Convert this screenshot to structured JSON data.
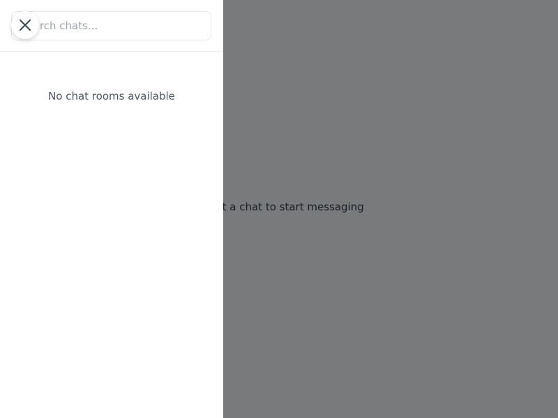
{
  "main": {
    "placeholder_text": "Select a chat to start messaging"
  },
  "sidebar": {
    "search": {
      "placeholder": "Search chats...",
      "value": ""
    },
    "close_icon": "close-icon",
    "empty_state": "No chat rooms available"
  },
  "colors": {
    "overlay": "#7a7a7a",
    "drawer_bg": "#ffffff",
    "border": "#e5e7eb",
    "muted_text": "#4b5563"
  }
}
